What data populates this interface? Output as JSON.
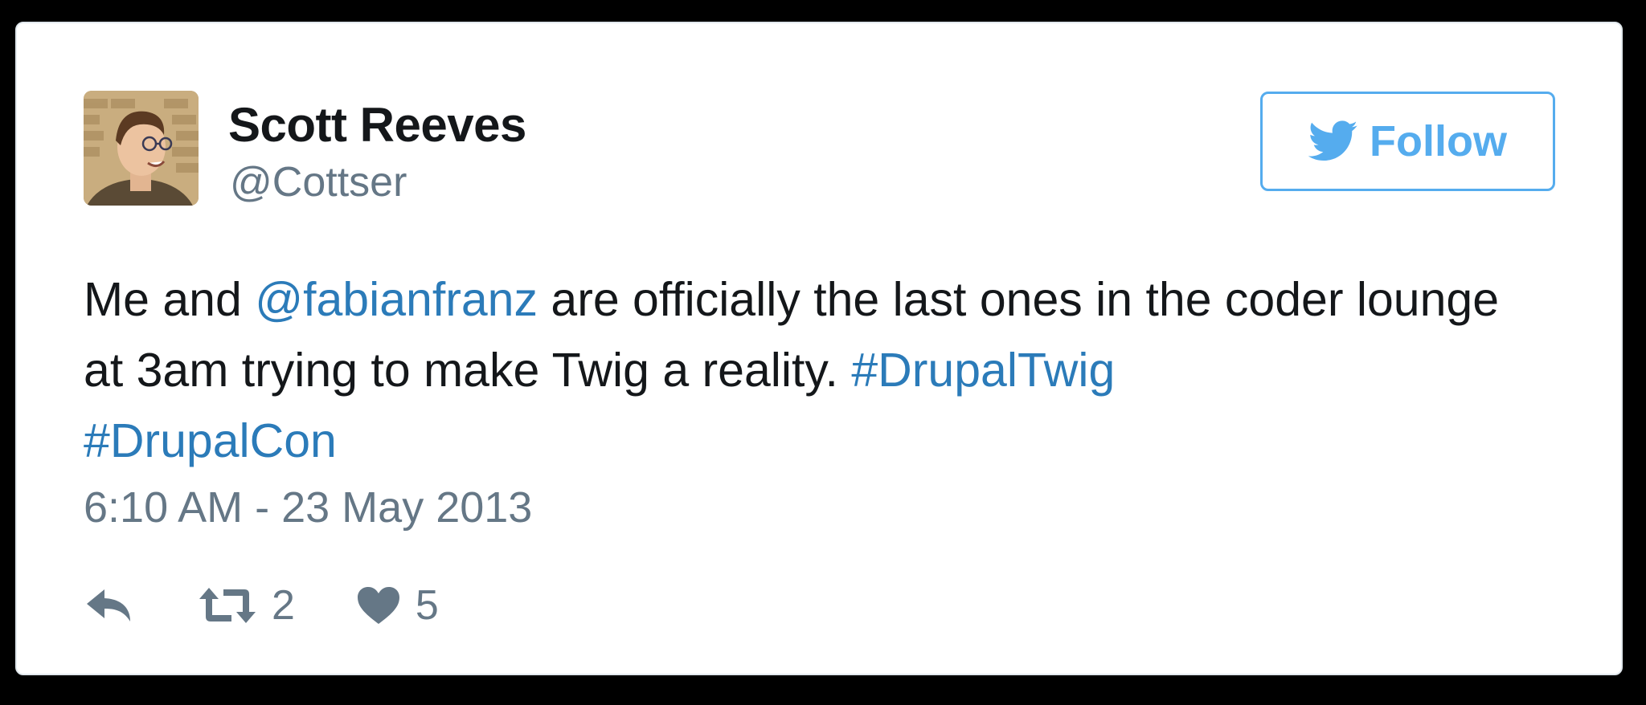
{
  "author": {
    "name": "Scott Reeves",
    "handle": "@Cottser"
  },
  "follow_button": {
    "label": "Follow",
    "icon": "twitter-bird-icon"
  },
  "tweet": {
    "segments": [
      {
        "text": "Me and ",
        "type": "text"
      },
      {
        "text": "@fabianfranz",
        "type": "mention"
      },
      {
        "text": " are officially the last ones in the coder lounge at 3am trying to make Twig a reality. ",
        "type": "text"
      },
      {
        "text": "#DrupalTwig",
        "type": "hashtag"
      },
      {
        "text": " ",
        "type": "text"
      },
      {
        "text": "#DrupalCon",
        "type": "hashtag"
      }
    ],
    "timestamp": "6:10 AM - 23 May 2013"
  },
  "actions": {
    "reply_icon": "reply-icon",
    "retweet_icon": "retweet-icon",
    "retweet_count": "2",
    "like_icon": "heart-icon",
    "like_count": "5"
  },
  "colors": {
    "link": "#2b7bb9",
    "twitter_blue": "#55acee",
    "muted": "#657786",
    "text": "#14171a"
  }
}
